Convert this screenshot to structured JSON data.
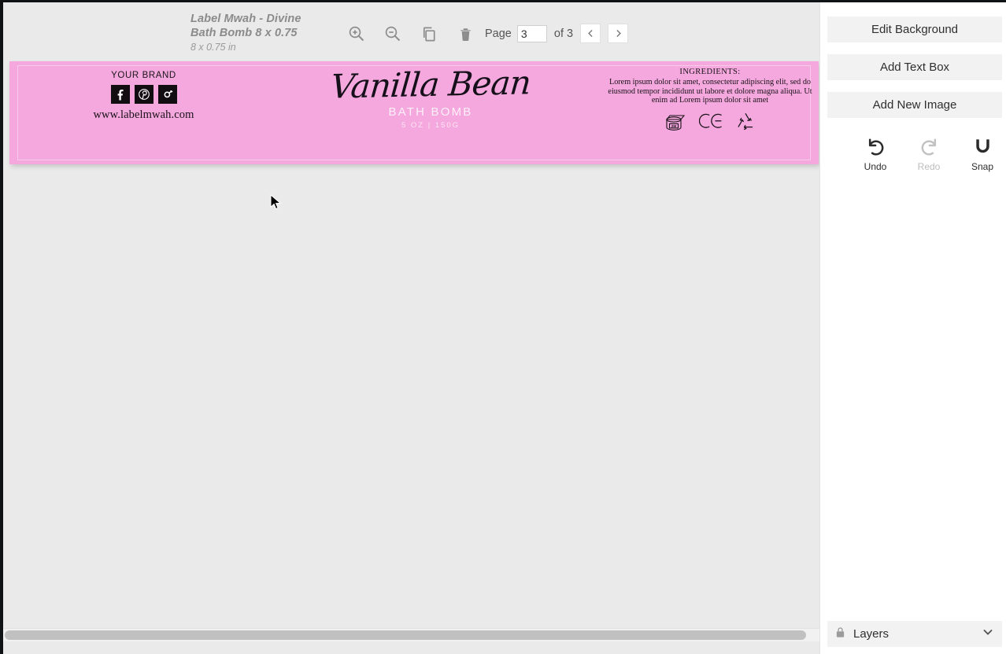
{
  "document": {
    "title": "Label Mwah - Divine Bath Bomb 8 x 0.75",
    "dimensions": "8 x 0.75 in"
  },
  "toolbar": {
    "icons": [
      {
        "name": "zoom-in-icon",
        "label": "Zoom In"
      },
      {
        "name": "zoom-out-icon",
        "label": "Zoom Out"
      },
      {
        "name": "duplicate-icon",
        "label": "Duplicate"
      },
      {
        "name": "delete-icon",
        "label": "Delete"
      }
    ],
    "pager": {
      "page_label": "Page",
      "page_value": "3",
      "of_label": "of 3",
      "total_pages": 3,
      "prev_icon": "chevron-left-icon",
      "next_icon": "chevron-right-icon"
    }
  },
  "label": {
    "background_color": "#f4a8de",
    "brand": {
      "name": "YOUR BRAND",
      "url": "www.labelmwah.com",
      "social": [
        {
          "name": "facebook-icon",
          "label": "Facebook"
        },
        {
          "name": "pinterest-icon",
          "label": "Pinterest"
        },
        {
          "name": "instagram-icon",
          "label": "Instagram"
        }
      ]
    },
    "product": {
      "script_name": "Vanilla Bean",
      "type": "BATH BOMB",
      "weight": "5 OZ  |  150G"
    },
    "ingredients": {
      "title": "INGREDIENTS:",
      "body": "Lorem ipsum dolor sit amet, consectetur adipiscing elit, sed do eiusmod tempor incididunt ut labore et dolore magna aliqua. Ut enim ad Lorem ipsum dolor sit amet",
      "symbols": [
        {
          "name": "period-after-opening-icon",
          "value": "2M"
        },
        {
          "name": "ce-mark-icon",
          "value": "CE"
        },
        {
          "name": "recycling-icon",
          "value": "Mobius loop"
        }
      ]
    }
  },
  "panel": {
    "edit_background": "Edit Background",
    "add_text_box": "Add Text Box",
    "add_new_image": "Add New Image",
    "actions": [
      {
        "name": "undo-icon",
        "label": "Undo",
        "disabled": false
      },
      {
        "name": "redo-icon",
        "label": "Redo",
        "disabled": true
      },
      {
        "name": "snap-magnet-icon",
        "label": "Snap",
        "disabled": false
      }
    ],
    "layers": {
      "label": "Layers",
      "lock_icon": "lock-icon",
      "chevron_icon": "chevron-down-icon"
    }
  },
  "colors": {
    "canvas_background": "#eaeaea",
    "panel_button": "#f2f2f2",
    "label_pink": "#f4a8de",
    "scrollbar_thumb": "#c0c0c0"
  }
}
